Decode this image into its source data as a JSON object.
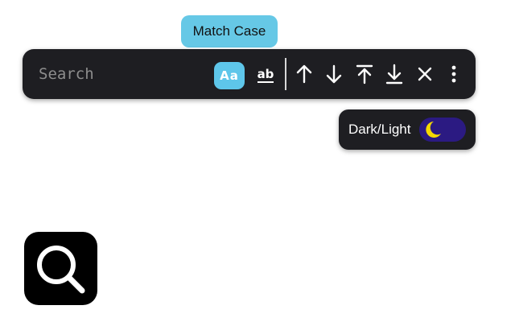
{
  "tooltip": {
    "text": "Match Case"
  },
  "search": {
    "placeholder": "Search",
    "value": "",
    "match_case_label": "Aa",
    "whole_word_label": "ab",
    "buttons": [
      "arrow-up-icon",
      "arrow-down-icon",
      "arrow-to-top-icon",
      "arrow-to-bottom-icon",
      "close-icon",
      "more-vertical-icon"
    ]
  },
  "theme_toggle": {
    "label": "Dark/Light",
    "icon": "moon-icon",
    "track_color": "#2b1a82",
    "moon_color": "#f5d800"
  },
  "app_icon": {
    "icon": "search-icon"
  },
  "colors": {
    "accent": "#5ec6ea",
    "bar_bg": "#1e1e22"
  }
}
